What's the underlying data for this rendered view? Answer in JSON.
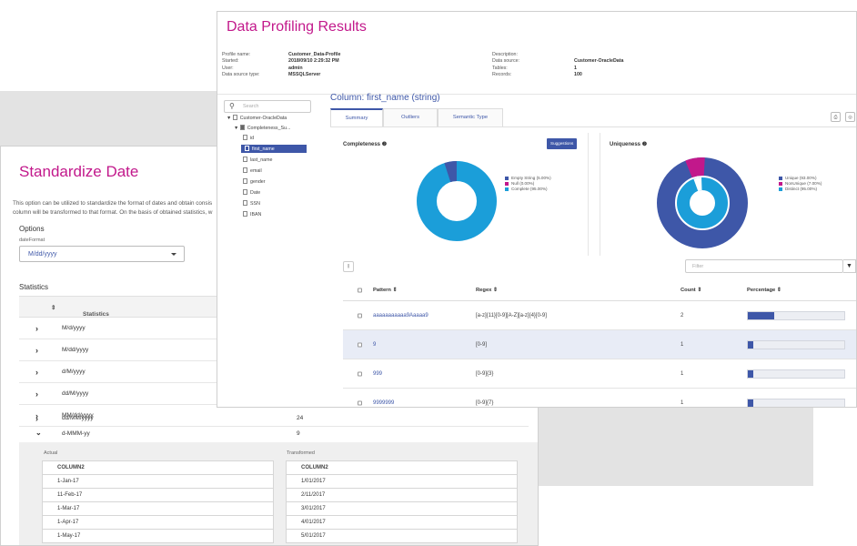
{
  "standardize": {
    "title": "Standardize Date",
    "desc_line1": "This option can be utilized to standardize the format of dates and obtain consis",
    "desc_line2": "column will be transformed to that format. On the basis of obtained statistics, w",
    "options_label": "Options",
    "format_field_label": "dateFormat",
    "format_value": "M/dd/yyyy",
    "statistics_label": "Statistics",
    "stats_column_header": "Statistics",
    "rows": [
      {
        "format": "M/d/yyyy",
        "count": ""
      },
      {
        "format": "M/dd/yyyy",
        "count": ""
      },
      {
        "format": "d/M/yyyy",
        "count": ""
      },
      {
        "format": "dd/M/yyyy",
        "count": ""
      },
      {
        "format": "MM/dd/yyyy",
        "count": ""
      },
      {
        "format": "dd/MM/yyyy",
        "count": "24"
      },
      {
        "format": "d-MMM-yy",
        "count": "9"
      }
    ],
    "expanded": {
      "actual_label": "Actual",
      "transformed_label": "Transformed",
      "column_header": "COLUMN2",
      "actual": [
        "1-Jan-17",
        "11-Feb-17",
        "1-Mar-17",
        "1-Apr-17",
        "1-May-17"
      ],
      "transformed": [
        "1/01/2017",
        "2/11/2017",
        "3/01/2017",
        "4/01/2017",
        "5/01/2017"
      ]
    }
  },
  "profiling": {
    "title": "Data Profiling Results",
    "meta_left_labels": [
      "Profile name:",
      "Started:",
      "User:",
      "Data source type:"
    ],
    "meta_left_values": [
      "Customer_Data-Profile",
      "2018/09/10 2:29:32 PM",
      "admin",
      "MSSQLServer"
    ],
    "meta_right_labels": [
      "Description:",
      "Data source:",
      "Tables:",
      "Records:"
    ],
    "meta_right_values": [
      "",
      "Customer-OracleData",
      "1",
      "100"
    ],
    "search_placeholder": "Search",
    "tree_root": "Customer-OracleData",
    "tree_group": "Completeness_Su...",
    "tree_items": [
      "id",
      "first_name",
      "last_name",
      "email",
      "gender",
      "Date",
      "SSN",
      "IBAN"
    ],
    "selected_item": "first_name",
    "column_title": "Column: first_name (string)",
    "tabs": [
      "Summary",
      "Outliers",
      "Semantic Type"
    ],
    "completeness": {
      "title": "Completeness",
      "suggestions_label": "Suggestions",
      "legend": [
        "Empty String (5.00%)",
        "Null (0.00%)",
        "Complete (95.00%)"
      ]
    },
    "uniqueness": {
      "title": "Uniqueness",
      "legend": [
        "Unique (93.00%)",
        "NonUnique (7.00%)",
        "Distinct (95.00%)"
      ]
    },
    "colors": {
      "accent": "#3e57a8",
      "magenta": "#c2188b",
      "cyan": "#1b9ed9"
    },
    "filter_placeholder": "Filter",
    "pattern_headers": [
      "Pattern",
      "Regex",
      "Count",
      "Percentage"
    ],
    "patterns": [
      {
        "pattern": "aaaaaaaaaaa9Aaaaa9",
        "regex": "[a-z]{11}[0-9][A-Z][a-z]{4}[0-9]",
        "count": "2",
        "pct": 0.27
      },
      {
        "pattern": "9",
        "regex": "[0-9]",
        "count": "1",
        "pct": 0.06
      },
      {
        "pattern": "999",
        "regex": "[0-9]{3}",
        "count": "1",
        "pct": 0.06
      },
      {
        "pattern": "9999999",
        "regex": "[0-9]{7}",
        "count": "1",
        "pct": 0.06
      }
    ]
  }
}
